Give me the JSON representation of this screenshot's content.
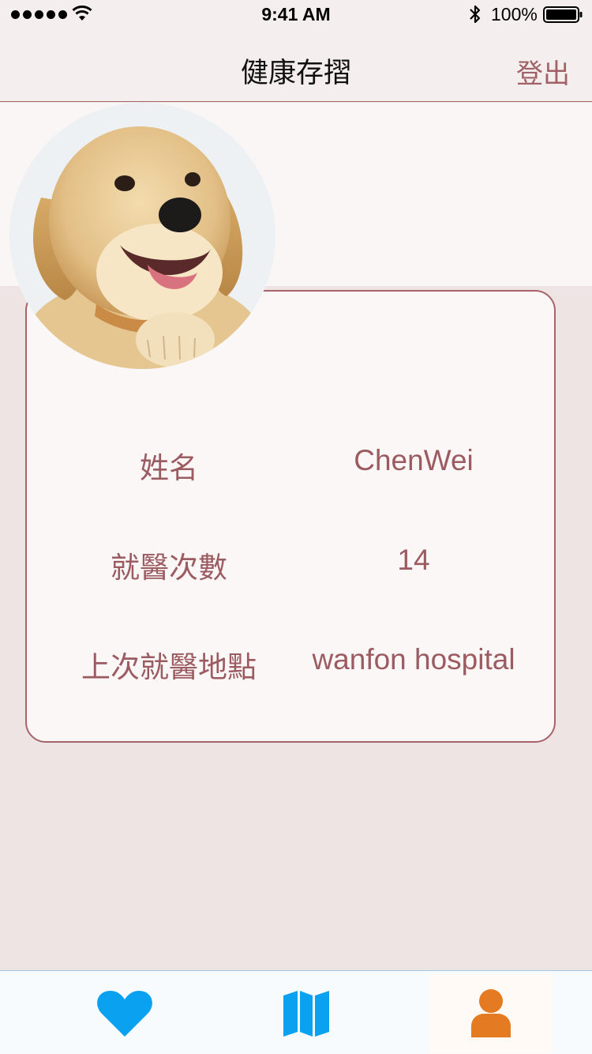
{
  "status_bar": {
    "time": "9:41 AM",
    "battery_percent": "100%",
    "signal_icon": "signal-dots-icon",
    "wifi_icon": "wifi-icon",
    "bluetooth_icon": "bluetooth-icon",
    "battery_icon": "battery-icon"
  },
  "nav": {
    "title": "健康存摺",
    "logout_label": "登出"
  },
  "profile": {
    "avatar": "dog-photo",
    "fields": [
      {
        "label": "姓名",
        "value": "ChenWei"
      },
      {
        "label": "就醫次數",
        "value": "14"
      },
      {
        "label": "上次就醫地點",
        "value": "wanfon hospital"
      }
    ]
  },
  "tab_bar": {
    "tabs": [
      {
        "icon": "heart-icon",
        "color": "#0aa2f0",
        "selected": false
      },
      {
        "icon": "map-icon",
        "color": "#0aa2f0",
        "selected": false
      },
      {
        "icon": "person-icon",
        "color": "#e47a22",
        "selected": true
      }
    ]
  },
  "colors": {
    "accent": "#a06266",
    "background": "#efe4e4",
    "card_bg": "#fbf7f7",
    "tab_blue": "#0aa2f0",
    "tab_orange": "#e47a22"
  }
}
